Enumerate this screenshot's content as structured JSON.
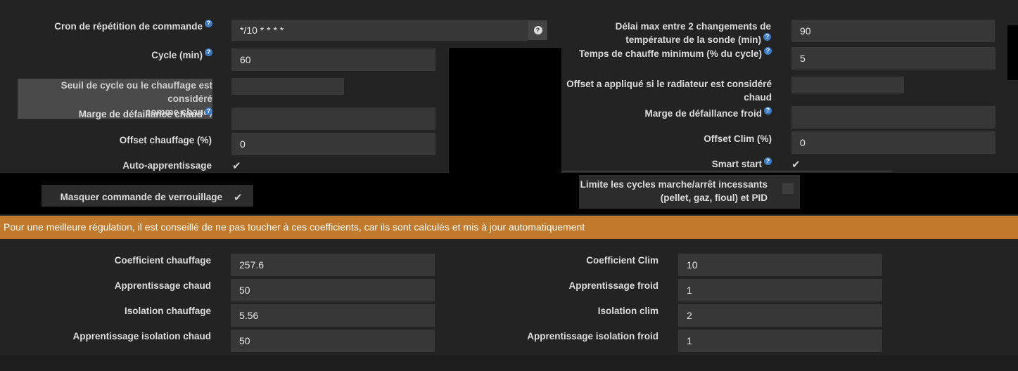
{
  "help_glyph": "?",
  "left": {
    "cron_label": "Cron de répétition de commande",
    "cron_value": "*/10 * * * *",
    "cycle_label": "Cycle (min)",
    "cycle_value": "60",
    "seuil_label_1": "Seuil de cycle ou le chauffage est considéré",
    "seuil_label_2": "comme chaud)",
    "seuil_value": "",
    "marge_chaud_label": "Marge de défaillance chaud",
    "marge_chaud_value": "",
    "offset_chauffage_label": "Offset chauffage (%)",
    "offset_chauffage_value": "0",
    "auto_apprentissage_label": "Auto-apprentissage",
    "auto_apprentissage_checked": true,
    "masquer_label": "Masquer commande de verrouillage",
    "masquer_checked": true
  },
  "right": {
    "delai_label_1": "Délai max entre 2 changements de",
    "delai_label_2": "température de la sonde (min)",
    "delai_value": "90",
    "temps_label": "Temps de chauffe minimum (% du cycle)",
    "temps_value": "5",
    "offset_rad_label_1": "Offset a appliqué si le radiateur est considéré",
    "offset_rad_label_2": "chaud",
    "offset_rad_value": "",
    "marge_froid_label": "Marge de défaillance froid",
    "marge_froid_value": "",
    "offset_clim_label": "Offset Clim (%)",
    "offset_clim_value": "0",
    "smart_start_label": "Smart start",
    "smart_start_checked": true,
    "limite_label_1": "Limite les cycles marche/arrêt incessants",
    "limite_label_2": "(pellet, gaz, fioul) et PID",
    "limite_checked": false
  },
  "banner": "Pour une meilleure régulation, il est conseillé de ne pas toucher à ces coefficients, car ils sont calculés et mis à jour automatiquement",
  "coefficients": {
    "coef_chauffage_label": "Coefficient chauffage",
    "coef_chauffage_value": "257.6",
    "appr_chaud_label": "Apprentissage chaud",
    "appr_chaud_value": "50",
    "iso_chauffage_label": "Isolation chauffage",
    "iso_chauffage_value": "5.56",
    "appr_iso_chaud_label": "Apprentissage isolation chaud",
    "appr_iso_chaud_value": "50",
    "coef_clim_label": "Coefficient Clim",
    "coef_clim_value": "10",
    "appr_froid_label": "Apprentissage froid",
    "appr_froid_value": "1",
    "iso_clim_label": "Isolation clim",
    "iso_clim_value": "2",
    "appr_iso_froid_label": "Apprentissage isolation froid",
    "appr_iso_froid_value": "1"
  },
  "colors": {
    "background": "#232323",
    "input": "#373737",
    "banner": "#c17a2b",
    "help_icon": "#3d7dc9"
  }
}
